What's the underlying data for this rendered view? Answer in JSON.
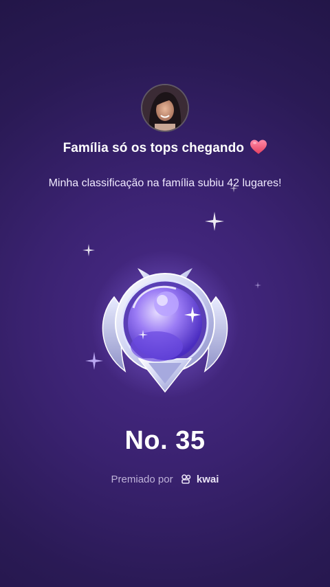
{
  "post": {
    "headline": "Família só os tops chegando",
    "subtitle": "Minha classificação na família subiu 42 lugares!",
    "rank": "No. 35",
    "credit_prefix": "Premiado por",
    "brand_name": "kwai"
  },
  "icons": {
    "heart": "heart-icon",
    "badge": "medal-badge-icon",
    "brand": "kwai-logo-icon",
    "sparkle": "sparkle-icon"
  },
  "colors": {
    "background": "#3a2270",
    "heart": "#ef4f7a",
    "credit_text": "#bfb3d9"
  }
}
